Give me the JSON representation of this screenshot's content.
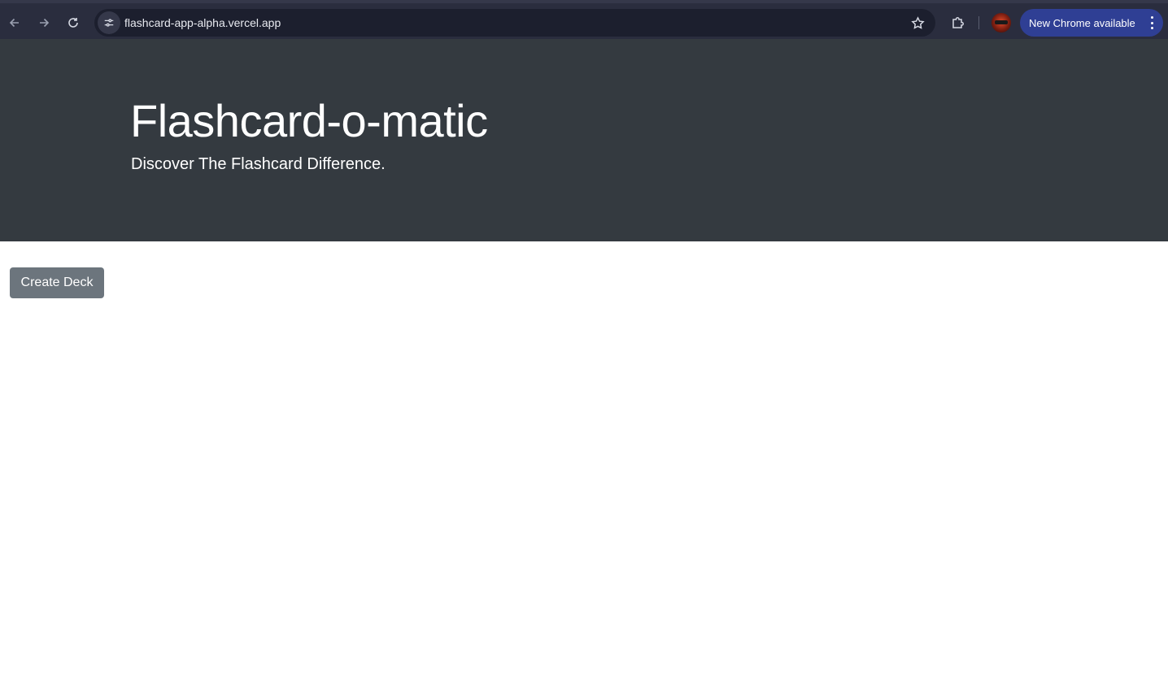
{
  "browser": {
    "url": "flashcard-app-alpha.vercel.app",
    "update_label": "New Chrome available",
    "icons": {
      "back": "arrow-left-icon",
      "forward": "arrow-right-icon",
      "reload": "reload-icon",
      "site_info": "tune-icon",
      "bookmark": "star-icon",
      "extensions": "puzzle-icon",
      "menu": "kebab-icon"
    },
    "colors": {
      "toolbar": "#2a2d3e",
      "omnibox": "#1c1f2e",
      "update_pill": "#2f3f94"
    }
  },
  "header": {
    "title": "Flashcard-o-matic",
    "subtitle": "Discover The Flashcard Difference.",
    "background": "#343a40"
  },
  "main": {
    "create_deck_label": "Create Deck",
    "button_color": "#6c757d"
  }
}
